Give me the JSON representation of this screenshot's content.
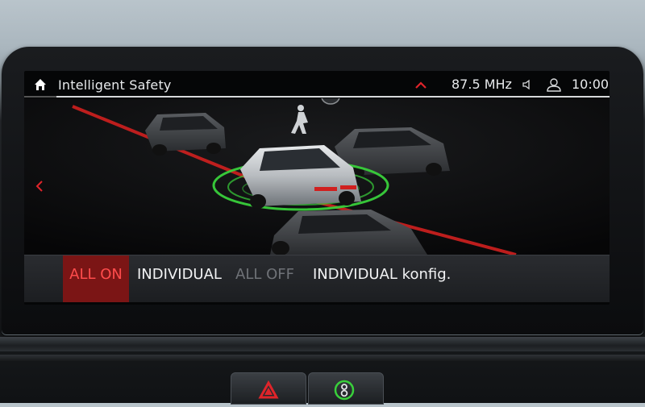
{
  "status_bar": {
    "title": "Intelligent Safety",
    "radio": "87.5 MHz",
    "time": "10:00"
  },
  "menu": {
    "items": [
      {
        "label": "ALL ON",
        "state": "selected"
      },
      {
        "label": "INDIVIDUAL",
        "state": "normal"
      },
      {
        "label": "ALL OFF",
        "state": "disabled"
      },
      {
        "label": "INDIVIDUAL konfig.",
        "state": "normal"
      }
    ]
  },
  "colors": {
    "accent_red": "#e0242a",
    "ring_green": "#39d03b",
    "selected_bg": "#7b1515"
  },
  "icons": [
    "home-icon",
    "chevron-up-icon",
    "speaker-icon",
    "profile-icon",
    "back-chevron-icon",
    "pedestrian-icon",
    "traffic-sign-icon",
    "hazard-icon",
    "drive-mode-icon"
  ]
}
